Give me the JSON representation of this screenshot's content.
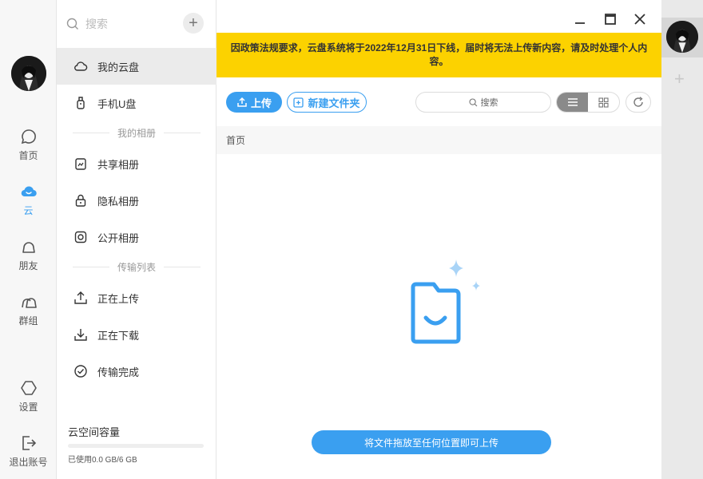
{
  "rail": {
    "items": [
      {
        "label": "首页",
        "icon": "chat-bubble-icon"
      },
      {
        "label": "云",
        "icon": "cloud-icon"
      },
      {
        "label": "朋友",
        "icon": "friend-icon"
      },
      {
        "label": "群组",
        "icon": "group-icon"
      },
      {
        "label": "设置",
        "icon": "hexagon-settings-icon"
      },
      {
        "label": "退出账号",
        "icon": "logout-icon"
      }
    ],
    "active": "云"
  },
  "sidebar": {
    "search_placeholder": "搜索",
    "items": [
      {
        "label": "我的云盘",
        "icon": "cloud-drive-icon"
      },
      {
        "label": "手机U盘",
        "icon": "usb-drive-icon"
      },
      {
        "label": "共享相册",
        "icon": "shared-album-icon"
      },
      {
        "label": "隐私相册",
        "icon": "lock-icon"
      },
      {
        "label": "公开相册",
        "icon": "camera-icon"
      },
      {
        "label": "正在上传",
        "icon": "upload-icon"
      },
      {
        "label": "正在下载",
        "icon": "download-icon"
      },
      {
        "label": "传输完成",
        "icon": "check-circle-icon"
      }
    ],
    "sections": {
      "albums": "我的相册",
      "transfers": "传输列表"
    },
    "storage": {
      "title": "云空间容量",
      "used_text": "已使用0.0 GB/6 GB",
      "used_fraction": 0
    }
  },
  "main": {
    "notice": "因政策法规要求，云盘系统将于2022年12月31日下线，届时将无法上传新内容，请及时处理个人内容。",
    "toolbar": {
      "upload_label": "上传",
      "new_folder_label": "新建文件夹",
      "search_placeholder": "搜索"
    },
    "breadcrumb": "首页",
    "drop_hint": "将文件拖放至任何位置即可上传"
  },
  "colors": {
    "accent": "#3a9ff0",
    "notice_bg": "#fcd200"
  }
}
